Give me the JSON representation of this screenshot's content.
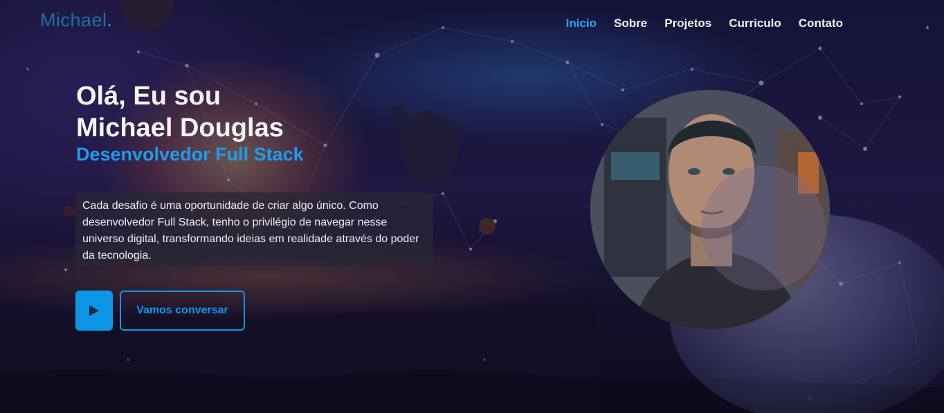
{
  "brand": {
    "name": "Michael",
    "dot": "."
  },
  "nav": {
    "items": [
      {
        "label": "Inicio",
        "active": true
      },
      {
        "label": "Sobre",
        "active": false
      },
      {
        "label": "Projetos",
        "active": false
      },
      {
        "label": "Curriculo",
        "active": false
      },
      {
        "label": "Contato",
        "active": false
      }
    ]
  },
  "hero": {
    "greeting_line1": "Olá, Eu sou",
    "greeting_line2": "Michael Douglas",
    "role": "Desenvolvedor Full Stack",
    "description": "Cada desafio é uma oportunidade de criar algo único. Como desenvolvedor Full Stack, tenho o privilégio de navegar nesse universo digital, transformando ideias em realidade através do poder da tecnologia.",
    "play_icon": "play-icon",
    "cta_label": "Vamos conversar"
  },
  "colors": {
    "accent": "#1d9cf0",
    "button": "#0d96e6",
    "logo": "#1f6fa8",
    "text": "#f4f4f8"
  }
}
